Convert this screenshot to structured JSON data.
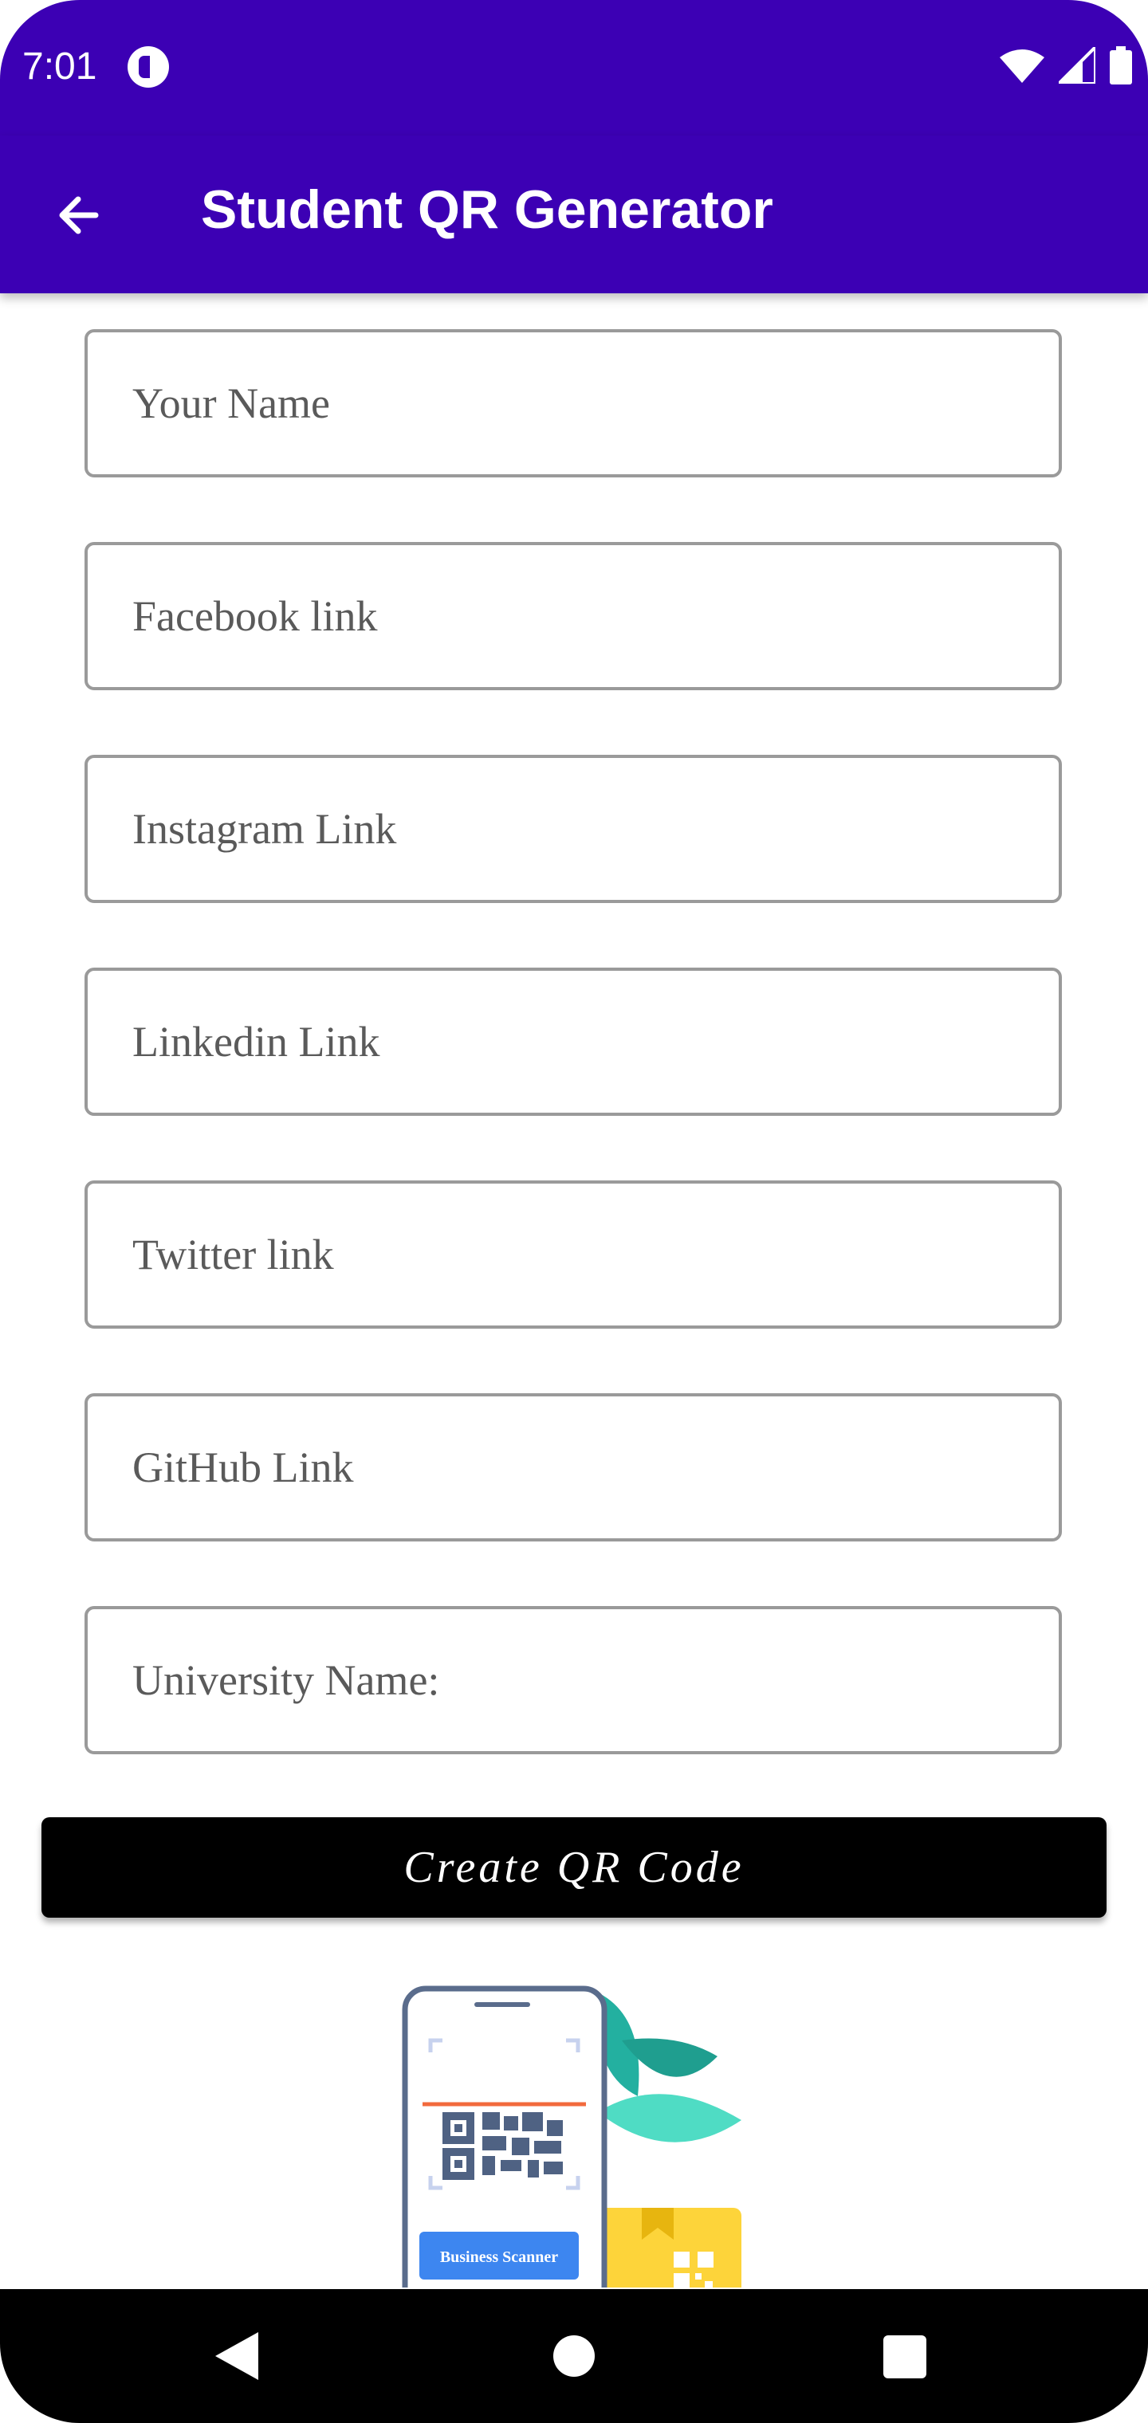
{
  "status_bar": {
    "time": "7:01",
    "icons": [
      "notification-icon",
      "wifi-icon",
      "signal-icon",
      "battery-icon"
    ]
  },
  "app_bar": {
    "title": "Student QR Generator",
    "back_icon": "arrow-back-icon"
  },
  "form": {
    "fields": [
      {
        "placeholder": "Your Name",
        "value": ""
      },
      {
        "placeholder": "Facebook link",
        "value": ""
      },
      {
        "placeholder": "Instagram Link",
        "value": ""
      },
      {
        "placeholder": "Linkedin Link",
        "value": ""
      },
      {
        "placeholder": "Twitter link",
        "value": ""
      },
      {
        "placeholder": "GitHub Link",
        "value": ""
      },
      {
        "placeholder": "University Name:",
        "value": ""
      }
    ],
    "create_button_label": "Create QR Code"
  },
  "illustration": {
    "scanner_label": "Business Scanner"
  },
  "colors": {
    "primary": "#3c00b4",
    "button": "#000000",
    "field_border": "#9a9a9a"
  },
  "nav_bar": {
    "icons": [
      "nav-back-icon",
      "nav-home-icon",
      "nav-recents-icon"
    ]
  }
}
